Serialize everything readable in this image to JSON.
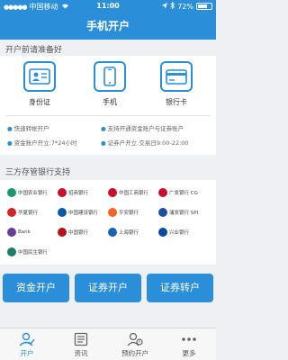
{
  "status": {
    "carrier": "中国移动",
    "time": "11:00",
    "battery_pct": "72%",
    "battery_level": 0.72
  },
  "nav": {
    "title": "手机开户"
  },
  "prep": {
    "title": "开户前请准备好",
    "items": [
      {
        "label": "身份证",
        "icon": "id-card-icon"
      },
      {
        "label": "手机",
        "icon": "phone-icon"
      },
      {
        "label": "银行卡",
        "icon": "bank-card-icon"
      }
    ],
    "notes": [
      "快速转帐开户",
      "支持开通资金账户与证券账户",
      "资金账户开立:7*24小时",
      "证券户开立:交易日9:00-22:00"
    ]
  },
  "banks": {
    "title": "三方存管银行支持",
    "list": [
      {
        "name": "中国农业银行",
        "color": "#1a9a6c"
      },
      {
        "name": "招商银行",
        "color": "#c8102e"
      },
      {
        "name": "中国工商银行",
        "color": "#c8102e"
      },
      {
        "name": "广发银行 CGB",
        "color": "#c8102e"
      },
      {
        "name": "华夏银行",
        "color": "#d2232a"
      },
      {
        "name": "中国建设银行",
        "color": "#0b5aa6"
      },
      {
        "name": "平安银行",
        "color": "#f26522"
      },
      {
        "name": "浦发银行 SPD BANK",
        "color": "#1d4fa0"
      },
      {
        "name": "Bank",
        "color": "#6a3d9a"
      },
      {
        "name": "中国银行",
        "color": "#b5121b"
      },
      {
        "name": "上海银行",
        "color": "#1b63b8"
      },
      {
        "name": "兴业银行",
        "color": "#0a4a9e"
      },
      {
        "name": "中国民生银行",
        "color": "#1a7e6b"
      }
    ]
  },
  "actions": {
    "fund": "资金开户",
    "securities": "证券开户",
    "transfer": "证券转户"
  },
  "tabs": [
    {
      "label": "开户",
      "icon": "person-check-icon"
    },
    {
      "label": "资讯",
      "icon": "news-icon"
    },
    {
      "label": "预约开户",
      "icon": "appointment-icon"
    },
    {
      "label": "更多",
      "icon": "more-icon"
    }
  ],
  "colors": {
    "primary": "#2a8ed8"
  }
}
